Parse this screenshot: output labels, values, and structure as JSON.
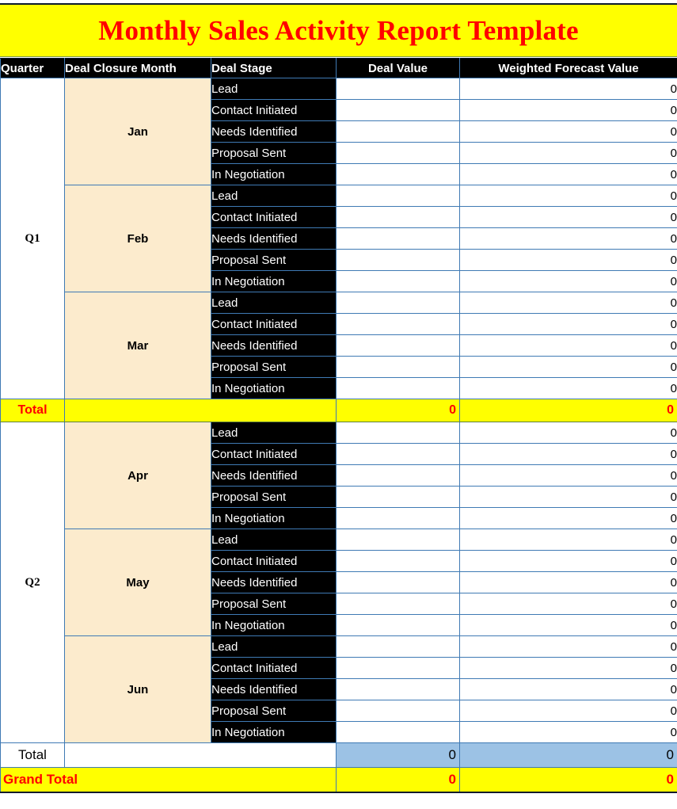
{
  "title": "Monthly Sales Activity Report Template",
  "colors": {
    "title_text": "#ff0000",
    "title_band": "#ffff00",
    "header_bg": "#000000",
    "header_text": "#ffffff",
    "month_bg": "#fcebcd",
    "stage_bg": "#000000",
    "grid_line": "#3f7ab4",
    "total_yellow": "#ffff00",
    "total_red": "#ff0000",
    "total_blue": "#9cc2e5"
  },
  "columns": [
    {
      "key": "quarter",
      "label": "Quarter"
    },
    {
      "key": "month",
      "label": "Deal Closure Month"
    },
    {
      "key": "stage",
      "label": "Deal Stage"
    },
    {
      "key": "deal_value",
      "label": "Deal Value"
    },
    {
      "key": "weighted",
      "label": "Weighted Forecast Value"
    }
  ],
  "stages": [
    "Lead",
    "Contact Initiated",
    "Needs Identified",
    "Proposal Sent",
    "In Negotiation"
  ],
  "quarters": [
    {
      "label": "Q1",
      "months": [
        {
          "name": "Jan",
          "rows": [
            {
              "stage": "Lead",
              "deal_value": "",
              "weighted": "0"
            },
            {
              "stage": "Contact Initiated",
              "deal_value": "",
              "weighted": "0"
            },
            {
              "stage": "Needs Identified",
              "deal_value": "",
              "weighted": "0"
            },
            {
              "stage": "Proposal Sent",
              "deal_value": "",
              "weighted": "0"
            },
            {
              "stage": "In Negotiation",
              "deal_value": "",
              "weighted": "0"
            }
          ]
        },
        {
          "name": "Feb",
          "rows": [
            {
              "stage": "Lead",
              "deal_value": "",
              "weighted": "0"
            },
            {
              "stage": "Contact Initiated",
              "deal_value": "",
              "weighted": "0"
            },
            {
              "stage": "Needs Identified",
              "deal_value": "",
              "weighted": "0"
            },
            {
              "stage": "Proposal Sent",
              "deal_value": "",
              "weighted": "0"
            },
            {
              "stage": "In Negotiation",
              "deal_value": "",
              "weighted": "0"
            }
          ]
        },
        {
          "name": "Mar",
          "rows": [
            {
              "stage": "Lead",
              "deal_value": "",
              "weighted": "0"
            },
            {
              "stage": "Contact Initiated",
              "deal_value": "",
              "weighted": "0"
            },
            {
              "stage": "Needs Identified",
              "deal_value": "",
              "weighted": "0"
            },
            {
              "stage": "Proposal Sent",
              "deal_value": "",
              "weighted": "0"
            },
            {
              "stage": "In Negotiation",
              "deal_value": "",
              "weighted": "0"
            }
          ]
        }
      ],
      "total": {
        "label": "Total",
        "deal_value": "0",
        "weighted": "0",
        "style": "yellow"
      }
    },
    {
      "label": "Q2",
      "months": [
        {
          "name": "Apr",
          "rows": [
            {
              "stage": "Lead",
              "deal_value": "",
              "weighted": "0"
            },
            {
              "stage": "Contact Initiated",
              "deal_value": "",
              "weighted": "0"
            },
            {
              "stage": "Needs Identified",
              "deal_value": "",
              "weighted": "0"
            },
            {
              "stage": "Proposal Sent",
              "deal_value": "",
              "weighted": "0"
            },
            {
              "stage": "In Negotiation",
              "deal_value": "",
              "weighted": "0"
            }
          ]
        },
        {
          "name": "May",
          "rows": [
            {
              "stage": "Lead",
              "deal_value": "",
              "weighted": "0"
            },
            {
              "stage": "Contact Initiated",
              "deal_value": "",
              "weighted": "0"
            },
            {
              "stage": "Needs Identified",
              "deal_value": "",
              "weighted": "0"
            },
            {
              "stage": "Proposal Sent",
              "deal_value": "",
              "weighted": "0"
            },
            {
              "stage": "In Negotiation",
              "deal_value": "",
              "weighted": "0"
            }
          ]
        },
        {
          "name": "Jun",
          "rows": [
            {
              "stage": "Lead",
              "deal_value": "",
              "weighted": "0"
            },
            {
              "stage": "Contact Initiated",
              "deal_value": "",
              "weighted": "0"
            },
            {
              "stage": "Needs Identified",
              "deal_value": "",
              "weighted": "0"
            },
            {
              "stage": "Proposal Sent",
              "deal_value": "",
              "weighted": "0"
            },
            {
              "stage": "In Negotiation",
              "deal_value": "",
              "weighted": "0"
            }
          ]
        }
      ],
      "total": {
        "label": "Total",
        "deal_value": "0",
        "weighted": "0",
        "style": "blue"
      }
    }
  ],
  "grand_total": {
    "label": "Grand Total",
    "deal_value": "0",
    "weighted": "0"
  }
}
